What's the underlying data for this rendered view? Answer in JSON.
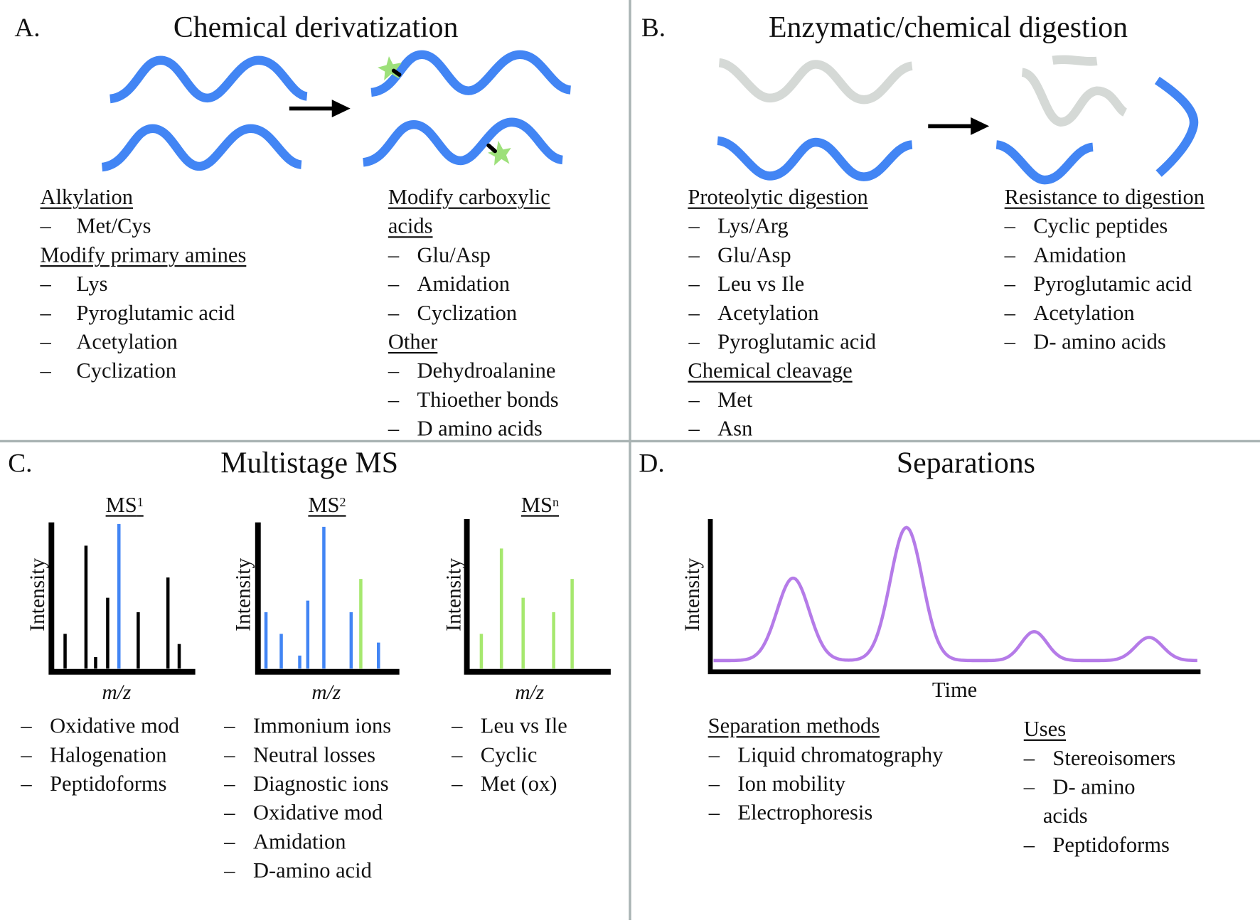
{
  "panels": {
    "A": {
      "letter": "A.",
      "title": "Chemical derivatization",
      "left": [
        {
          "h": "Alkylation"
        },
        {
          "i": "Met/Cys"
        },
        {
          "h": "Modify primary amines"
        },
        {
          "i": "Lys"
        },
        {
          "i": "Pyroglutamic acid"
        },
        {
          "i": "Acetylation"
        },
        {
          "i": "Cyclization"
        }
      ],
      "right": [
        {
          "h": "Modify carboxylic"
        },
        {
          "h": "acids"
        },
        {
          "i": "Glu/Asp"
        },
        {
          "i": "Amidation"
        },
        {
          "i": "Cyclization"
        },
        {
          "h": "Other"
        },
        {
          "i": "Dehydroalanine"
        },
        {
          "i": "Thioether bonds"
        },
        {
          "i": "D amino acids"
        }
      ]
    },
    "B": {
      "letter": "B.",
      "title": "Enzymatic/chemical digestion",
      "left": [
        {
          "h": "Proteolytic digestion"
        },
        {
          "i": "Lys/Arg"
        },
        {
          "i": "Glu/Asp"
        },
        {
          "i": "Leu vs Ile"
        },
        {
          "i": "Acetylation"
        },
        {
          "i": "Pyroglutamic acid"
        },
        {
          "h": "Chemical cleavage"
        },
        {
          "i": "Met"
        },
        {
          "i": "Asn"
        }
      ],
      "right": [
        {
          "h": "Resistance to digestion"
        },
        {
          "i": "Cyclic peptides"
        },
        {
          "i": "Amidation"
        },
        {
          "i": "Pyroglutamic acid"
        },
        {
          "i": "Acetylation"
        },
        {
          "i": "D- amino acids"
        }
      ]
    },
    "C": {
      "letter": "C.",
      "title": "Multistage MS",
      "spectra": [
        {
          "label": "MS",
          "sup": "1",
          "xlabel": "m/z",
          "ylabel": "Intensity",
          "items": [
            "Oxidative mod",
            "Halogenation",
            "Peptidoforms"
          ]
        },
        {
          "label": "MS",
          "sup": "2",
          "xlabel": "m/z",
          "ylabel": "Intensity",
          "items": [
            "Immonium ions",
            "Neutral losses",
            "Diagnostic ions",
            "Oxidative mod",
            "Amidation",
            "D-amino acid"
          ]
        },
        {
          "label": "MS",
          "sup": "n",
          "xlabel": "m/z",
          "ylabel": "Intensity",
          "items": [
            "Leu vs Ile",
            "Cyclic",
            "Met (ox)"
          ]
        }
      ]
    },
    "D": {
      "letter": "D.",
      "title": "Separations",
      "xlabel": "Time",
      "ylabel": "Intensity",
      "methods": {
        "h": "Separation methods",
        "items": [
          "Liquid chromatography",
          "Ion mobility",
          "Electrophoresis"
        ]
      },
      "uses": {
        "h": "Uses",
        "items": [
          "Stereoisomers",
          "D- amino",
          "acids",
          "Peptidoforms"
        ]
      }
    }
  },
  "colors": {
    "peptide": "#4285f4",
    "digested": "#d5d9d6",
    "label_star": "#9de07a",
    "ms_green": "#a6e86f",
    "chromatogram": "#b57be8",
    "divider": "#a9b3b3",
    "axis": "#000000"
  },
  "chart_data": [
    {
      "type": "bar",
      "name": "MS1",
      "ylabel": "Intensity",
      "xlabel": "m/z",
      "values_relative": [
        0.24,
        0.85,
        0.08,
        0.49,
        1.0,
        0.39,
        0.63,
        0.17
      ],
      "colors": [
        "black",
        "black",
        "black",
        "black",
        "blue",
        "black",
        "black",
        "black"
      ]
    },
    {
      "type": "bar",
      "name": "MS2",
      "ylabel": "Intensity",
      "xlabel": "m/z",
      "values_relative": [
        0.39,
        0.24,
        0.09,
        0.47,
        0.98,
        0.39,
        0.62,
        0.18
      ],
      "colors": [
        "blue",
        "blue",
        "blue",
        "blue",
        "blue",
        "blue",
        "green",
        "blue"
      ]
    },
    {
      "type": "bar",
      "name": "MSn",
      "ylabel": "Intensity",
      "xlabel": "m/z",
      "values_relative": [
        0.24,
        0.83,
        0.49,
        0.39,
        0.62
      ],
      "colors": [
        "green",
        "green",
        "green",
        "green",
        "green"
      ]
    },
    {
      "type": "line",
      "name": "chromatogram",
      "xlabel": "Time",
      "ylabel": "Intensity",
      "peaks_relative": [
        0.57,
        0.92,
        0.2,
        0.16
      ]
    }
  ]
}
